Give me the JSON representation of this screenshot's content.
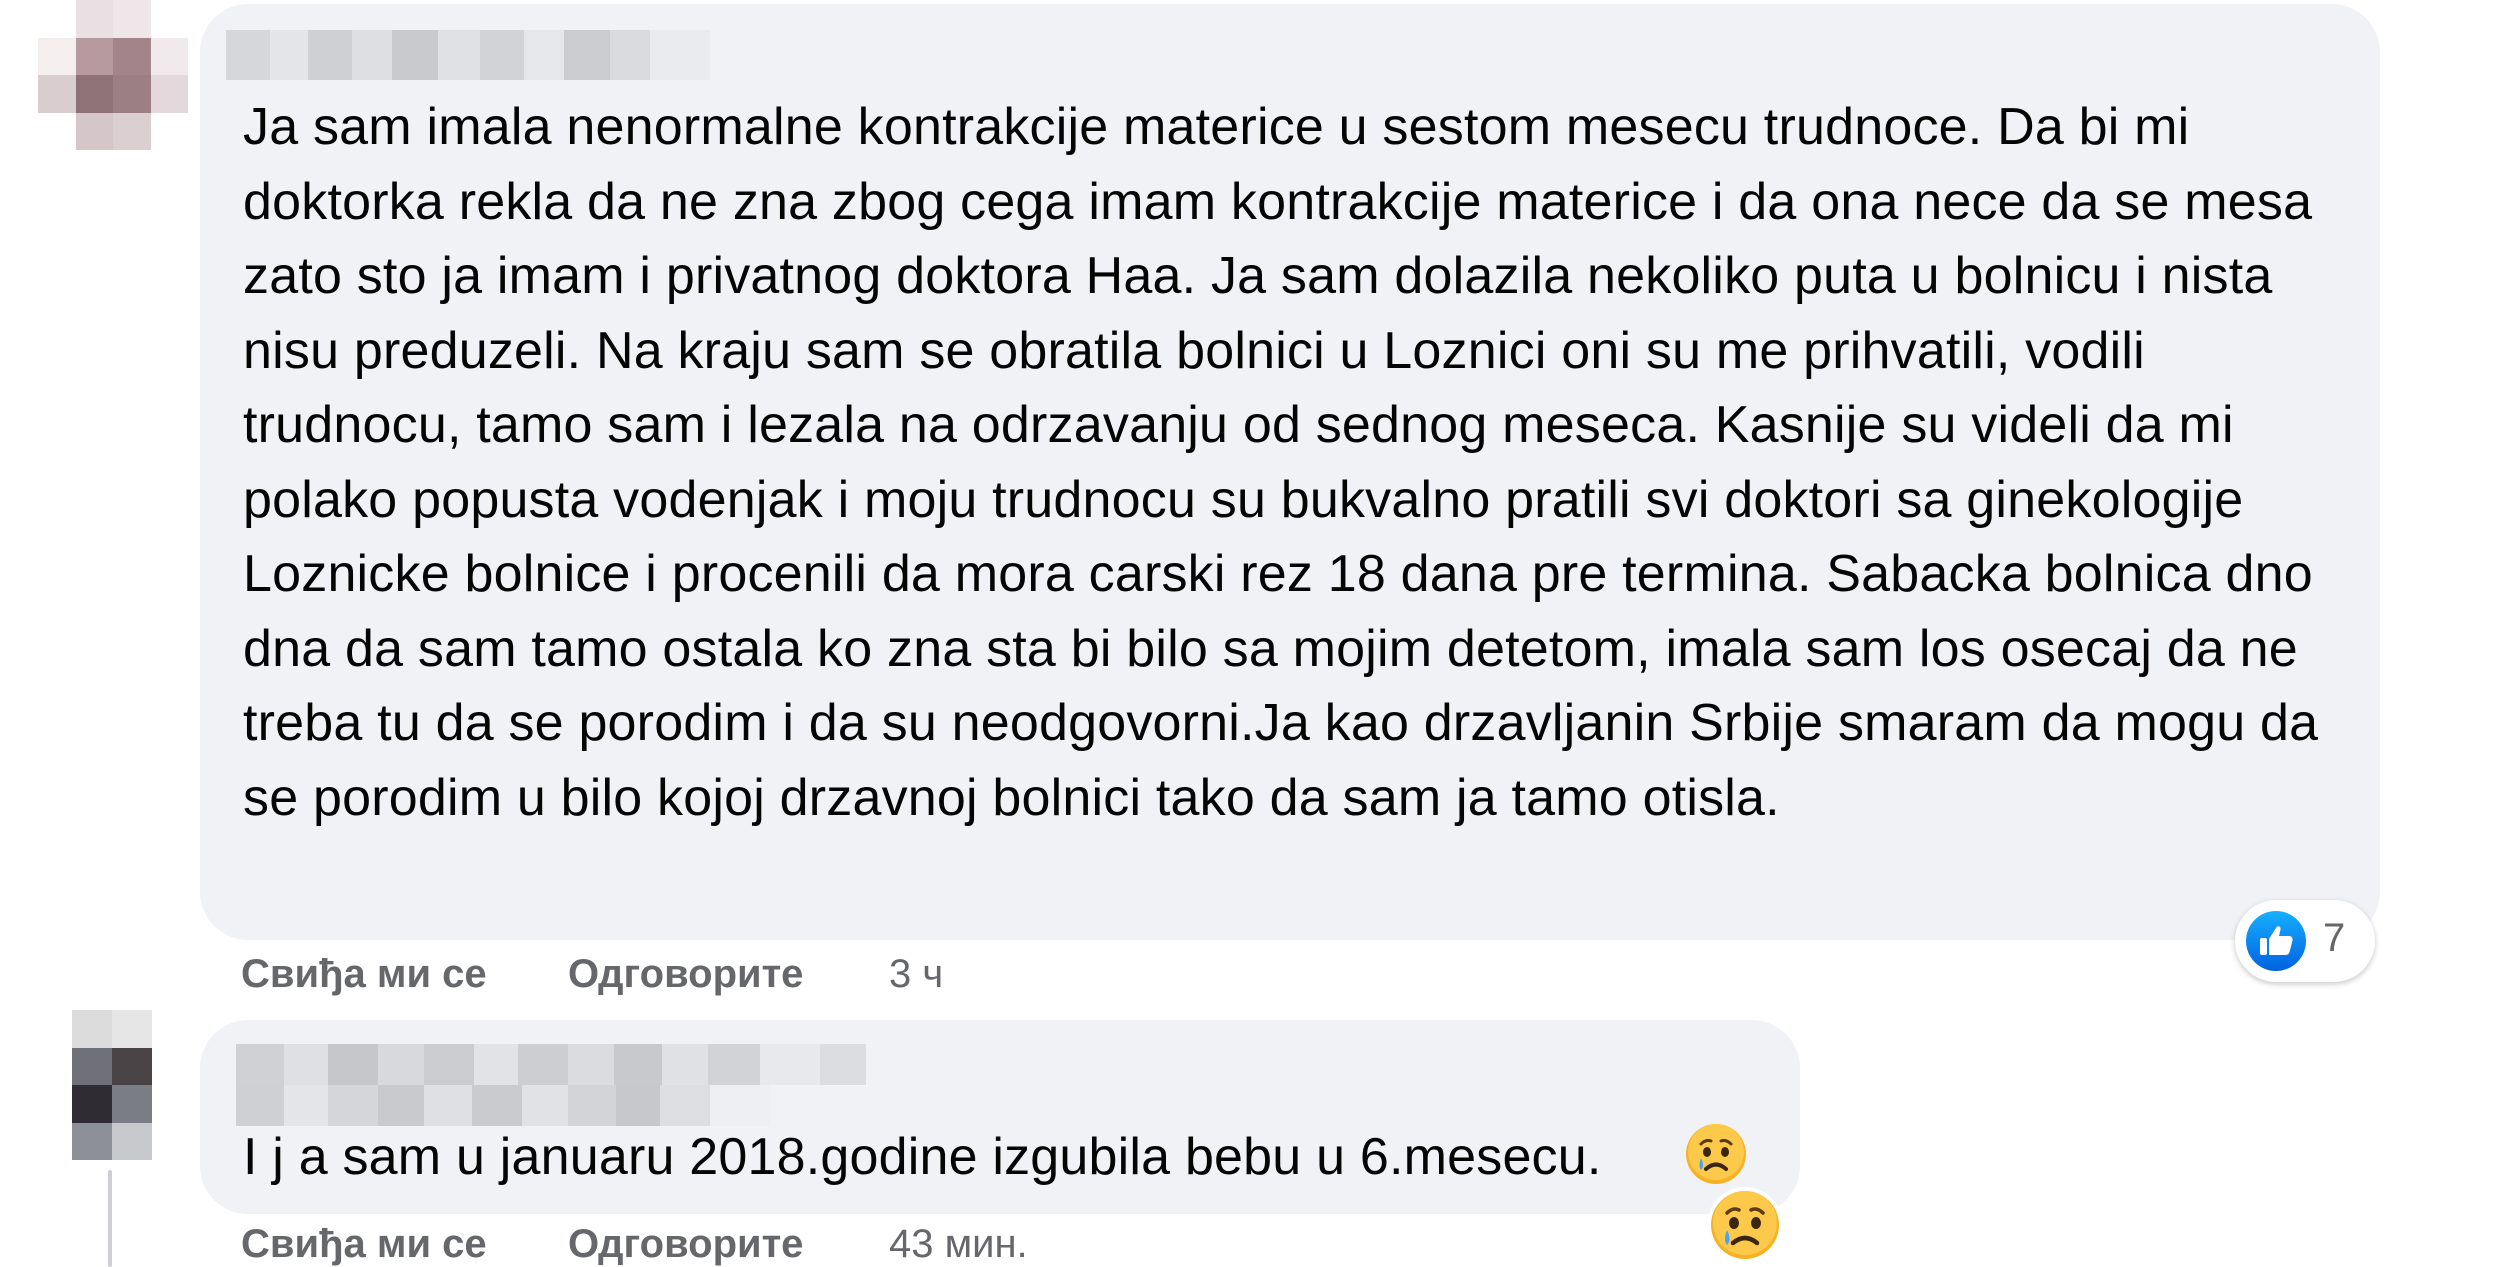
{
  "comments": [
    {
      "text": "Ja sam imala nenormalne kontrakcije materice u sestom mesecu trudnoce. Da bi mi doktorka rekla da ne zna zbog cega imam kontrakcije materice i da ona nece da se mesa zato sto ja imam i privatnog doktora Haa. Ja sam dolazila nekoliko puta u bolnicu i nista nisu preduzeli. Na kraju sam se obratila bolnici u Loznici oni su me prihvatili, vodili trudnocu, tamo sam i lezala na odrzavanju od sednog meseca. Kasnije su videli da mi polako popusta vodenjak i moju trudnocu su bukvalno pratili svi doktori sa ginekologije Loznicke bolnice i procenili da mora carski rez 18 dana pre termina. Sabacka bolnica dno dna da sam tamo ostala ko zna sta bi bilo sa mojim detetom, imala sam los osecaj da ne treba tu da se porodim i da su neodgovorni.Ja kao drzavljanin Srbije smaram da mogu da se porodim u bilo kojoj drzavnoj bolnici tako da sam ja tamo otisla.",
      "like_label": "Свиђа ми се",
      "reply_label": "Одговорите",
      "timestamp": "3 ч",
      "reaction_count": "7",
      "reaction_icon": "like-thumbs-up-icon"
    },
    {
      "text": "I j a sam u januaru 2018.godine izgubila bebu u 6.mesecu.",
      "like_label": "Свиђа ми се",
      "reply_label": "Одговорите",
      "timestamp": "43 мин.",
      "reaction_icon": "sad-face-icon"
    }
  ],
  "colors": {
    "bubble_bg": "#f0f2f5",
    "text": "#050505",
    "secondary_text": "#65676b",
    "like_blue": "#1877f2",
    "sad_yellow": "#f7b125"
  }
}
